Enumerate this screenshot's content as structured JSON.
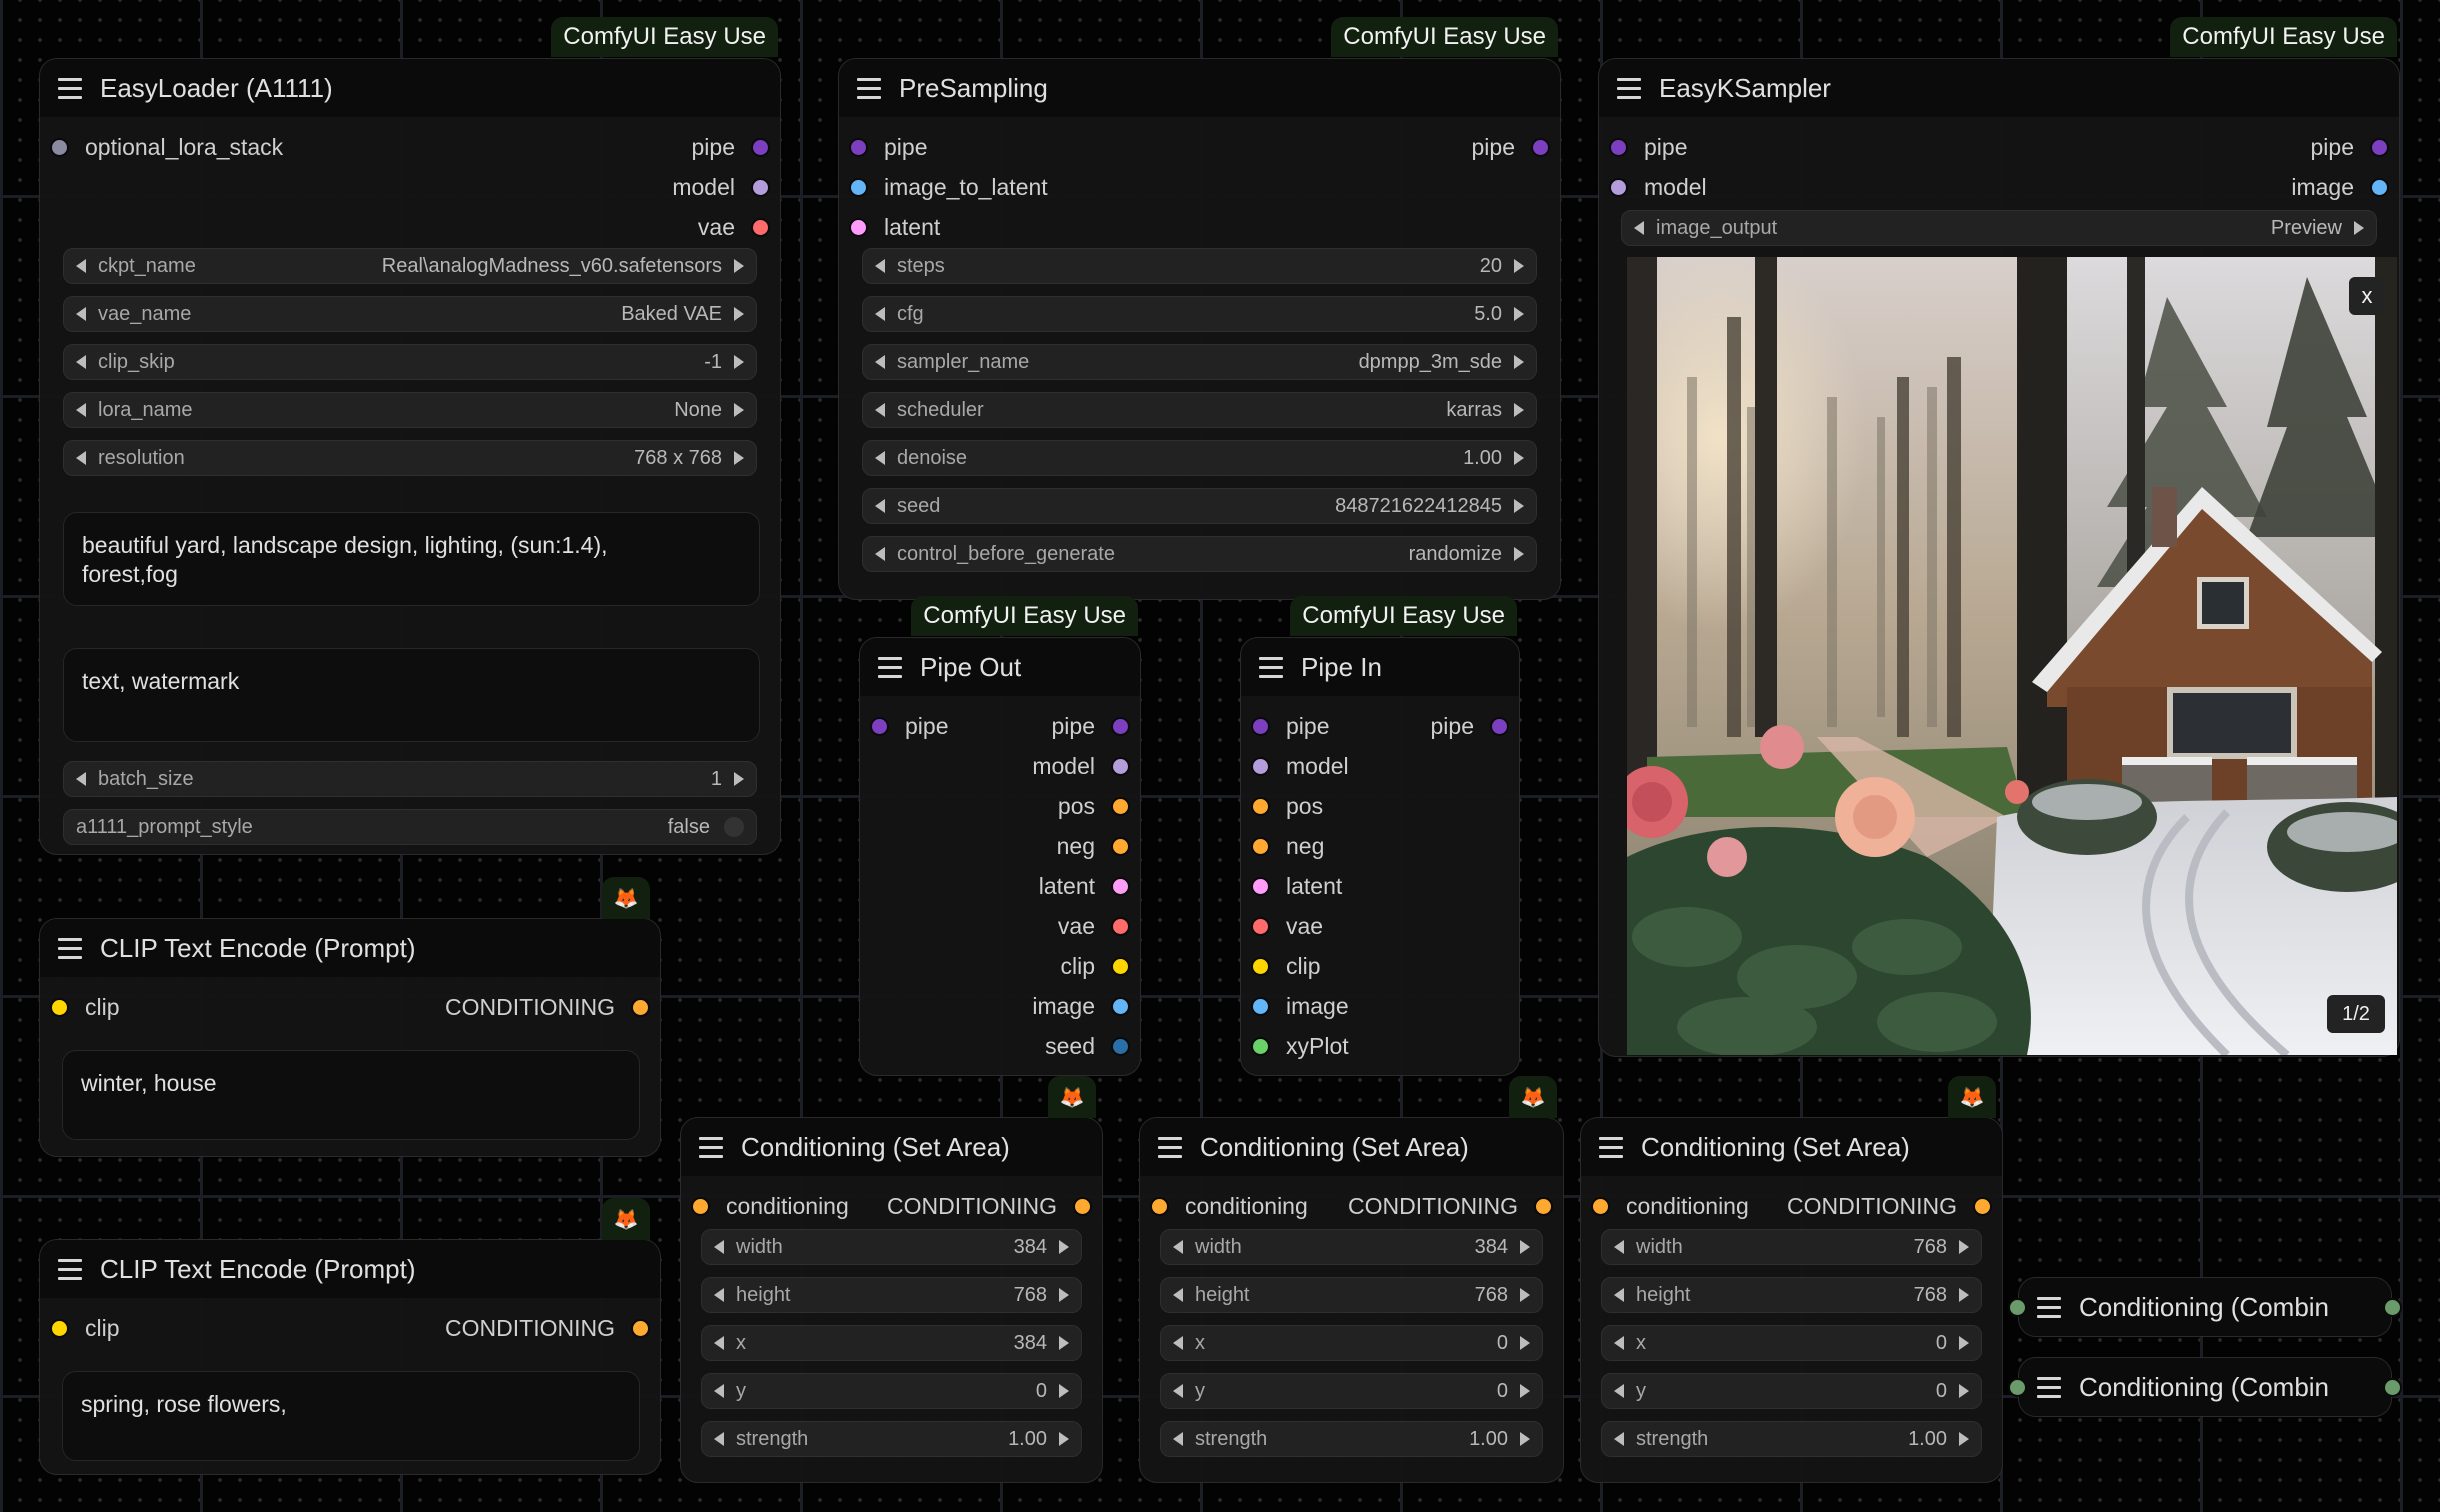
{
  "colors": {
    "pipe": "#7b3fbf",
    "model": "#b39ddb",
    "vae": "#ff6b6b",
    "optional": "#8a8aa0",
    "image": "#64b5f6",
    "latent": "#ff9cf9",
    "conditioning": "#ffa931",
    "clip": "#ffd500",
    "seed": "#2b6fa8",
    "xyplot": "#6ad06a",
    "combine": "#6b9a6b",
    "badge_bg": "#12200f"
  },
  "badge_text": "ComfyUI Easy Use",
  "fox_icon": "🦊",
  "easyloader": {
    "title": "EasyLoader (A1111)",
    "inputs": [
      {
        "label": "optional_lora_stack",
        "type": "optional"
      }
    ],
    "outputs": [
      {
        "label": "pipe",
        "type": "pipe"
      },
      {
        "label": "model",
        "type": "model"
      },
      {
        "label": "vae",
        "type": "vae"
      }
    ],
    "widgets": [
      {
        "label": "ckpt_name",
        "value": "Real\\analogMadness_v60.safetensors"
      },
      {
        "label": "vae_name",
        "value": "Baked VAE"
      },
      {
        "label": "clip_skip",
        "value": "-1"
      },
      {
        "label": "lora_name",
        "value": "None"
      },
      {
        "label": "resolution",
        "value": "768 x 768"
      }
    ],
    "positive_prompt": "beautiful yard, landscape design, lighting, (sun:1.4),\nforest,fog",
    "negative_prompt": "text, watermark",
    "batch_size": {
      "label": "batch_size",
      "value": "1"
    },
    "prompt_style": {
      "label": "a1111_prompt_style",
      "value": "false"
    }
  },
  "presampling": {
    "title": "PreSampling",
    "inputs": [
      {
        "label": "pipe",
        "type": "pipe"
      },
      {
        "label": "image_to_latent",
        "type": "image"
      },
      {
        "label": "latent",
        "type": "latent"
      }
    ],
    "outputs": [
      {
        "label": "pipe",
        "type": "pipe"
      }
    ],
    "widgets": [
      {
        "label": "steps",
        "value": "20"
      },
      {
        "label": "cfg",
        "value": "5.0"
      },
      {
        "label": "sampler_name",
        "value": "dpmpp_3m_sde"
      },
      {
        "label": "scheduler",
        "value": "karras"
      },
      {
        "label": "denoise",
        "value": "1.00"
      },
      {
        "label": "seed",
        "value": "848721622412845"
      },
      {
        "label": "control_before_generate",
        "value": "randomize"
      }
    ]
  },
  "ksampler": {
    "title": "EasyKSampler",
    "inputs": [
      {
        "label": "pipe",
        "type": "pipe"
      },
      {
        "label": "model",
        "type": "model"
      }
    ],
    "outputs": [
      {
        "label": "pipe",
        "type": "pipe"
      },
      {
        "label": "image",
        "type": "image"
      }
    ],
    "widgets": [
      {
        "label": "image_output",
        "value": "Preview"
      }
    ],
    "preview": {
      "close_label": "x",
      "counter": "1/2",
      "alt": "Generated image: foggy forest path with rose bushes on the left and a snow-covered wooden cabin on the right"
    }
  },
  "pipe_out": {
    "title": "Pipe Out",
    "inputs": [
      {
        "label": "pipe",
        "type": "pipe"
      }
    ],
    "outputs": [
      {
        "label": "pipe",
        "type": "pipe"
      },
      {
        "label": "model",
        "type": "model"
      },
      {
        "label": "pos",
        "type": "conditioning"
      },
      {
        "label": "neg",
        "type": "conditioning"
      },
      {
        "label": "latent",
        "type": "latent"
      },
      {
        "label": "vae",
        "type": "vae"
      },
      {
        "label": "clip",
        "type": "clip"
      },
      {
        "label": "image",
        "type": "image"
      },
      {
        "label": "seed",
        "type": "seed"
      }
    ]
  },
  "pipe_in": {
    "title": "Pipe In",
    "inputs": [
      {
        "label": "pipe",
        "type": "pipe"
      },
      {
        "label": "model",
        "type": "model"
      },
      {
        "label": "pos",
        "type": "conditioning"
      },
      {
        "label": "neg",
        "type": "conditioning"
      },
      {
        "label": "latent",
        "type": "latent"
      },
      {
        "label": "vae",
        "type": "vae"
      },
      {
        "label": "clip",
        "type": "clip"
      },
      {
        "label": "image",
        "type": "image"
      },
      {
        "label": "xyPlot",
        "type": "xyplot"
      }
    ],
    "outputs": [
      {
        "label": "pipe",
        "type": "pipe"
      }
    ]
  },
  "clip_encoders": [
    {
      "title": "CLIP Text Encode (Prompt)",
      "input": "clip",
      "output": "CONDITIONING",
      "text": "winter, house"
    },
    {
      "title": "CLIP Text Encode (Prompt)",
      "input": "clip",
      "output": "CONDITIONING",
      "text": "spring, rose flowers,"
    }
  ],
  "set_area_nodes": [
    {
      "title": "Conditioning (Set Area)",
      "input": "conditioning",
      "output": "CONDITIONING",
      "widgets": [
        {
          "label": "width",
          "value": "384"
        },
        {
          "label": "height",
          "value": "768"
        },
        {
          "label": "x",
          "value": "384"
        },
        {
          "label": "y",
          "value": "0"
        },
        {
          "label": "strength",
          "value": "1.00"
        }
      ]
    },
    {
      "title": "Conditioning (Set Area)",
      "input": "conditioning",
      "output": "CONDITIONING",
      "widgets": [
        {
          "label": "width",
          "value": "384"
        },
        {
          "label": "height",
          "value": "768"
        },
        {
          "label": "x",
          "value": "0"
        },
        {
          "label": "y",
          "value": "0"
        },
        {
          "label": "strength",
          "value": "1.00"
        }
      ]
    },
    {
      "title": "Conditioning (Set Area)",
      "input": "conditioning",
      "output": "CONDITIONING",
      "widgets": [
        {
          "label": "width",
          "value": "768"
        },
        {
          "label": "height",
          "value": "768"
        },
        {
          "label": "x",
          "value": "0"
        },
        {
          "label": "y",
          "value": "0"
        },
        {
          "label": "strength",
          "value": "1.00"
        }
      ]
    }
  ],
  "combine_nodes": [
    {
      "title": "Conditioning (Combin"
    },
    {
      "title": "Conditioning (Combin"
    }
  ]
}
